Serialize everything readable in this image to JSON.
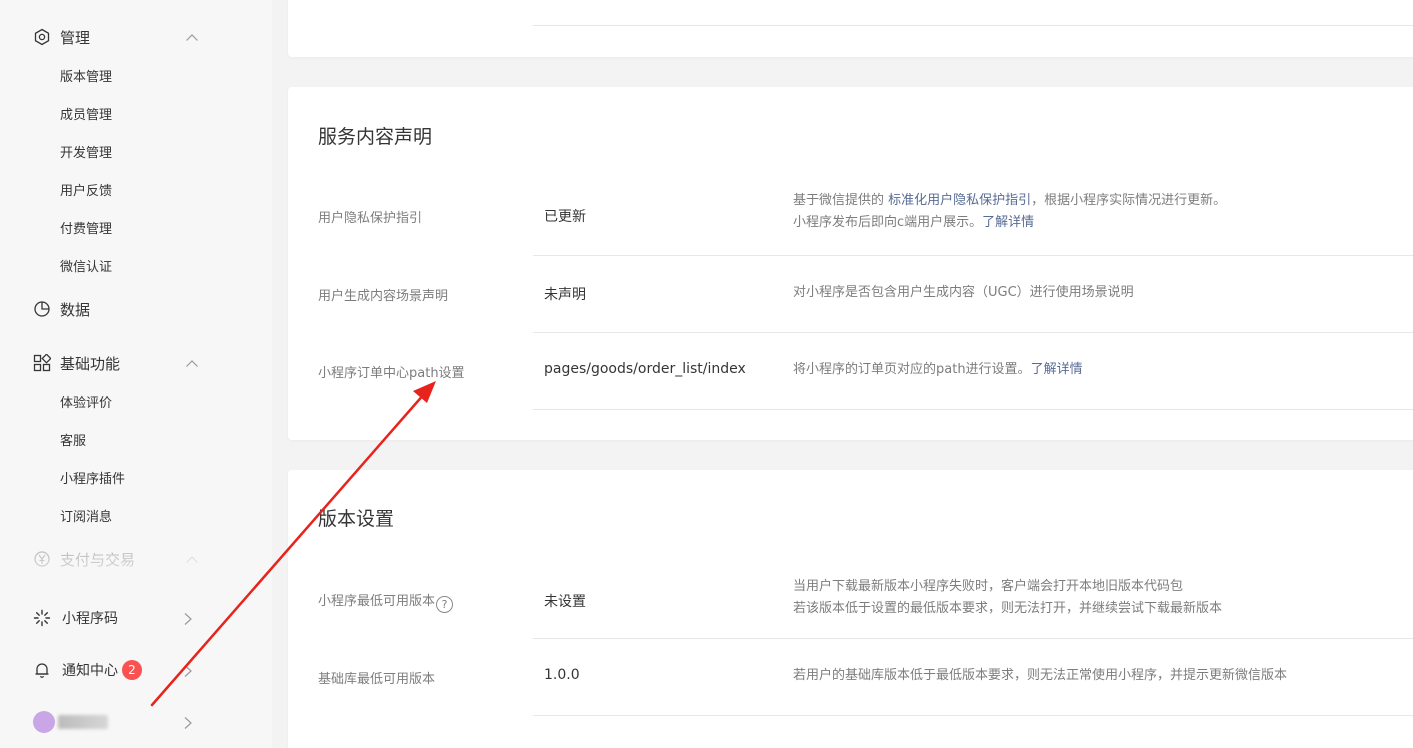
{
  "sidebar": {
    "manage": {
      "label": "管理",
      "items": [
        "版本管理",
        "成员管理",
        "开发管理",
        "用户反馈",
        "付费管理",
        "微信认证"
      ]
    },
    "data": {
      "label": "数据"
    },
    "basic": {
      "label": "基础功能",
      "items": [
        "体验评价",
        "客服",
        "小程序插件",
        "订阅消息"
      ]
    },
    "payment": {
      "label": "支付与交易"
    },
    "bottom": {
      "qrcode_label": "小程序码",
      "notify_label": "通知中心",
      "notify_count": "2"
    }
  },
  "service_card": {
    "title": "服务内容声明",
    "rows": [
      {
        "label": "用户隐私保护指引",
        "value": "已更新",
        "desc_line1_prefix": "基于微信提供的 ",
        "desc_line1_link": "标准化用户隐私保护指引",
        "desc_line1_suffix": "，根据小程序实际情况进行更新。",
        "desc_line2_prefix": "小程序发布后即向c端用户展示。",
        "desc_line2_link": "了解详情"
      },
      {
        "label": "用户生成内容场景声明",
        "value": "未声明",
        "desc": "对小程序是否包含用户生成内容（UGC）进行使用场景说明"
      },
      {
        "label": "小程序订单中心path设置",
        "value": "pages/goods/order_list/index",
        "desc_prefix": "将小程序的订单页对应的path进行设置。",
        "desc_link": "了解详情"
      }
    ]
  },
  "version_card": {
    "title": "版本设置",
    "rows": [
      {
        "label": "小程序最低可用版本",
        "help_glyph": "?",
        "value": "未设置",
        "desc_line1": "当用户下载最新版本小程序失败时，客户端会打开本地旧版本代码包",
        "desc_line2": "若该版本低于设置的最低版本要求，则无法打开，并继续尝试下载最新版本"
      },
      {
        "label": "基础库最低可用版本",
        "value": "1.0.0",
        "desc": "若用户的基础库版本低于最低版本要求，则无法正常使用小程序，并提示更新微信版本"
      }
    ]
  },
  "colors": {
    "link": "#576b95",
    "badge": "#fa5151",
    "annotation_arrow": "#e8231d"
  },
  "icons": [
    "settings-icon",
    "chevron-up-icon",
    "pie-chart-icon",
    "grid-icon",
    "yen-icon",
    "qrcode-icon",
    "bell-icon",
    "chevron-right-icon",
    "help-icon"
  ]
}
